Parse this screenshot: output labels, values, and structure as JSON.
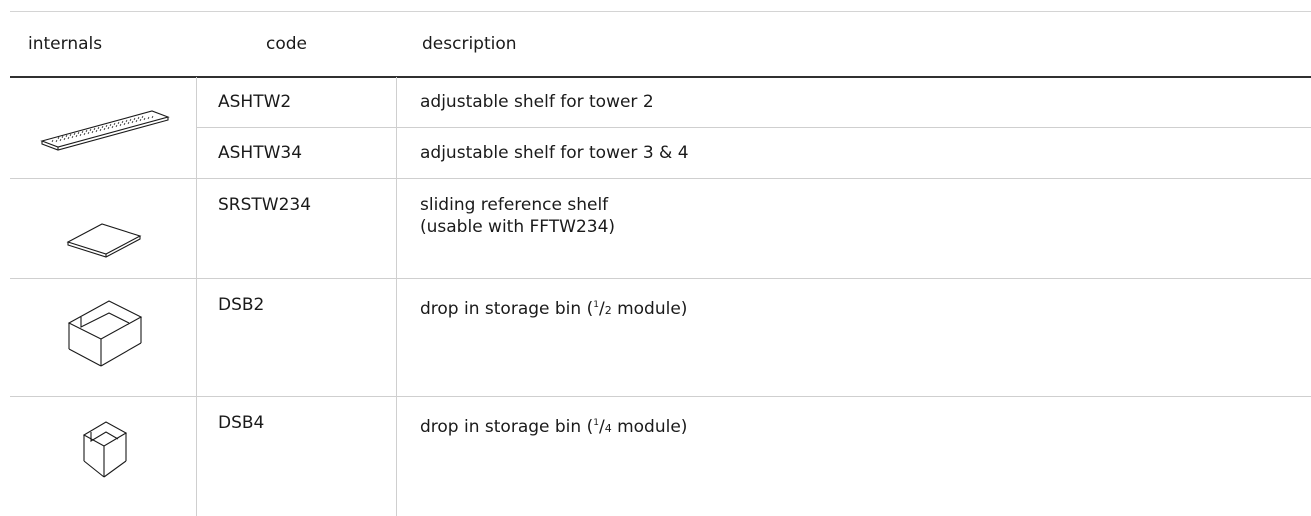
{
  "headers": {
    "internals": "internals",
    "code": "code",
    "description": "description"
  },
  "rows": [
    {
      "icon": "adjustable-shelf-icon",
      "code": "ASHTW2",
      "description": "adjustable shelf for tower 2"
    },
    {
      "icon": "adjustable-shelf-icon",
      "code": "ASHTW34",
      "description": "adjustable shelf for tower 3 & 4"
    },
    {
      "icon": "sliding-shelf-icon",
      "code": "SRSTW234",
      "description": "sliding reference shelf",
      "description_line2": "(usable with FFTW234)"
    },
    {
      "icon": "storage-bin-half-icon",
      "code": "DSB2",
      "description_pre": "drop in storage bin (",
      "fraction_num": "1",
      "fraction_den": "2",
      "description_post": " module)"
    },
    {
      "icon": "storage-bin-quarter-icon",
      "code": "DSB4",
      "description_pre": "drop in storage bin (",
      "fraction_num": "1",
      "fraction_den": "4",
      "description_post": " module)"
    }
  ]
}
